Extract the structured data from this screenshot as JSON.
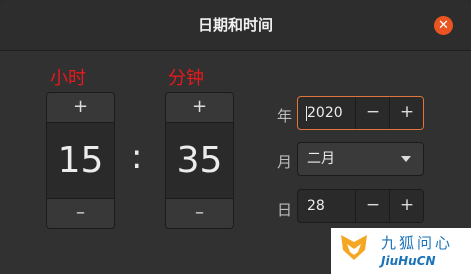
{
  "window": {
    "title": "日期和时间",
    "close_glyph": "✕"
  },
  "time": {
    "hour_label": "小时",
    "minute_label": "分钟",
    "hour_value": "15",
    "minute_value": "35",
    "separator": ":",
    "increment_glyph": "+",
    "decrement_glyph": "–"
  },
  "date": {
    "year_label": "年",
    "year_value": "2020",
    "month_label": "月",
    "month_value": "二月",
    "day_label": "日",
    "day_value": "28",
    "increment_glyph": "+",
    "decrement_glyph": "−"
  },
  "watermark": {
    "text_cn": "九狐问心",
    "text_en": "JiuHuCN"
  },
  "colors": {
    "accent": "#e95420",
    "label_red": "#e8191c",
    "focus_border": "#e2743e",
    "background": "#313131"
  },
  "icons": {
    "close": "close-icon",
    "dropdown": "chevron-down-icon",
    "watermark_logo": "fox-logo-icon"
  }
}
